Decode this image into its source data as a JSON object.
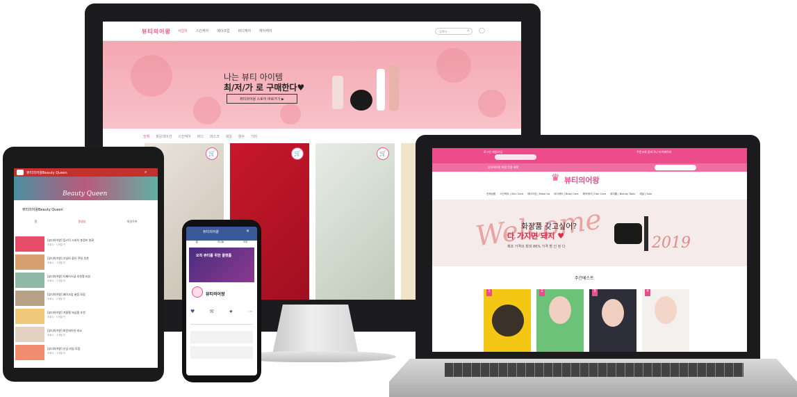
{
  "desktop": {
    "logo": "뷰티의어왕",
    "menu": [
      "사업자",
      "스킨케어",
      "메이크업",
      "바디케어",
      "헤어케어"
    ],
    "menu_active": 0,
    "search_placeholder": "검색어",
    "hero_line1": "나는 뷰티 아이템",
    "hero_line2": "최/저/가 로 구매한다♥",
    "hero_button": "뷰티의어왕 스토어 바로가기 ▶",
    "category_tabs": [
      "전체",
      "파운데이션",
      "스킨케어",
      "바디",
      "마스크",
      "네일",
      "향수",
      "기타"
    ]
  },
  "laptop": {
    "top_left": "로그인  회원가입",
    "top_right": "주문조회  장바구니  마이페이지",
    "pink_bar": "뷰티의어왕 회원 전용 혜택",
    "logo": "뷰티의어왕",
    "menu": [
      "전체상품",
      "스킨케어 | Skin Care",
      "메이크업 | Make Up",
      "바디케어 | Body Care",
      "헤어케어 | Hair Care",
      "뷰티툴 | Beauty Tools",
      "세일 | Sale"
    ],
    "banner_welcome": "Welcome",
    "banner_line1": "화장품 갖고싶어?",
    "banner_line2": "다 가지면 돼지 ♥",
    "banner_line3": "제조 가격의 최대 86% 가격 할 인 된 다",
    "banner_year": "2019",
    "section_title": "주간베스트",
    "best_numbers": [
      "1",
      "2",
      "3",
      "4"
    ]
  },
  "tablet": {
    "app_title": "뷰티의어왕Beauty Queen",
    "banner_text": "Beauty Queen",
    "channel_name": "뷰티의어왕Beauty Queen",
    "tabs": [
      "홈",
      "동영상",
      "재생목록"
    ],
    "videos": [
      {
        "title": "[뷰티의어왕] 립스틱 스와치 총정리 완료",
        "meta": "조회수 · 1개월 전"
      },
      {
        "title": "[뷰티의어왕] 가성비 좋은 쿠션 추천",
        "meta": "조회수 · 1개월 전"
      },
      {
        "title": "[뷰티의어왕] 더페이스샵 추천템 리뷰",
        "meta": "조회수 · 2개월 전"
      },
      {
        "title": "[뷰티의어왕] 메이크업 꿀팁 모음",
        "meta": "조회수 · 2개월 전"
      },
      {
        "title": "[뷰티의어왕] 겨울철 보습템 추천",
        "meta": "조회수 · 3개월 전"
      },
      {
        "title": "[뷰티의어왕] 파운데이션 비교",
        "meta": "조회수 · 3개월 전"
      },
      {
        "title": "[뷰티의어왕] 신상 리뷰 모음",
        "meta": "조회수 · 4개월 전"
      }
    ]
  },
  "phone": {
    "top_title": "뷰티의어왕",
    "tabs": [
      "홈",
      "게시물",
      "리뷰"
    ],
    "cover_text": "오직 뷰티를 위한 플랫폼",
    "page_name": "뷰티의어왕",
    "actions": [
      "♥",
      "✉",
      "★",
      "⋯"
    ]
  },
  "colors": {
    "brand_pink": "#ec4d8a",
    "hero_pink": "#f4a7b3",
    "accent_red": "#e5274b",
    "facebook_blue": "#3b5998",
    "youtube_red": "#c4302b"
  }
}
